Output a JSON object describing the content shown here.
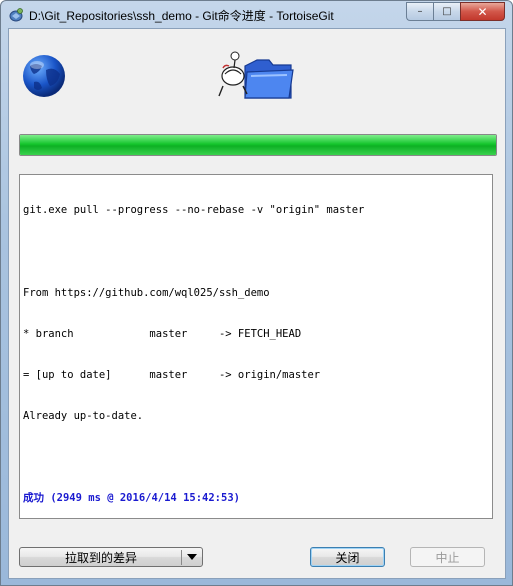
{
  "window": {
    "title": "D:\\Git_Repositories\\ssh_demo - Git命令进度 - TortoiseGit",
    "controls": {
      "minimize": "–",
      "maximize": "□",
      "close": "✕"
    }
  },
  "icons": {
    "app": "tortoisegit-icon",
    "globe": "globe-icon",
    "animation": "tortoise-folder-icon"
  },
  "progress": {
    "value": 1.0
  },
  "log": {
    "lines": [
      "git.exe pull --progress --no-rebase -v \"origin\" master",
      "",
      "From https://github.com/wql025/ssh_demo",
      "* branch            master     -> FETCH_HEAD",
      "= [up to date]      master     -> origin/master",
      "Already up-to-date.",
      ""
    ],
    "success_line": "成功 (2949 ms @ 2016/4/14 15:42:53)"
  },
  "buttons": {
    "diff": "拉取到的差异",
    "close": "关闭",
    "abort": "中止"
  }
}
